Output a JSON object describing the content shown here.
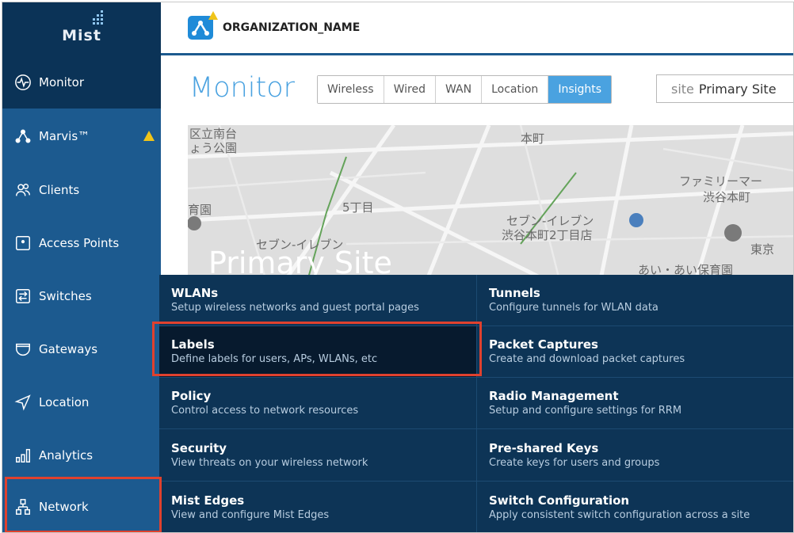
{
  "app": {
    "logo_text": "Mist",
    "org_name": "ORGANIZATION_NAME"
  },
  "sidebar": {
    "items": [
      {
        "label": "Monitor",
        "icon": "pulse-icon",
        "active": true
      },
      {
        "label": "Marvis™",
        "icon": "marvis-icon",
        "warning": true
      },
      {
        "label": "Clients",
        "icon": "users-icon"
      },
      {
        "label": "Access Points",
        "icon": "access-point-icon"
      },
      {
        "label": "Switches",
        "icon": "switch-icon"
      },
      {
        "label": "Gateways",
        "icon": "gateway-icon"
      },
      {
        "label": "Location",
        "icon": "location-arrow-icon"
      },
      {
        "label": "Analytics",
        "icon": "bar-chart-icon"
      },
      {
        "label": "Network",
        "icon": "network-icon"
      }
    ]
  },
  "header": {
    "title": "Monitor",
    "tabs": [
      {
        "label": "Wireless"
      },
      {
        "label": "Wired"
      },
      {
        "label": "WAN"
      },
      {
        "label": "Location"
      },
      {
        "label": "Insights",
        "active": true
      }
    ],
    "site_label": "site",
    "site_value": "Primary Site"
  },
  "map": {
    "site_name": "Primary Site",
    "labels": [
      "区立南台",
      "ょう公園",
      "本町",
      "ファミリーマー",
      "渋谷本町",
      "5丁目",
      "セブン-イレブン",
      "渋谷本町2丁目店",
      "セブン-イレブン",
      "東京",
      "あい・あい保育園",
      "育園"
    ]
  },
  "network_menu": {
    "left": [
      {
        "title": "WLANs",
        "desc": "Setup wireless networks and guest portal pages"
      },
      {
        "title": "Labels",
        "desc": "Define labels for users, APs, WLANs, etc"
      },
      {
        "title": "Policy",
        "desc": "Control access to network resources"
      },
      {
        "title": "Security",
        "desc": "View threats on your wireless network"
      },
      {
        "title": "Mist Edges",
        "desc": "View and configure Mist Edges"
      }
    ],
    "right": [
      {
        "title": "Tunnels",
        "desc": "Configure tunnels for WLAN data"
      },
      {
        "title": "Packet Captures",
        "desc": "Create and download packet captures"
      },
      {
        "title": "Radio Management",
        "desc": "Setup and configure settings for RRM"
      },
      {
        "title": "Pre-shared Keys",
        "desc": "Create keys for users and groups"
      },
      {
        "title": "Switch Configuration",
        "desc": "Apply consistent switch configuration across a site"
      }
    ]
  },
  "colors": {
    "sidebar": "#1c5a8f",
    "sidebar_active": "#0b3357",
    "accent": "#4aa2e0",
    "menu_bg": "#0d3456",
    "highlight": "#e0412e",
    "warning": "#f0c419"
  }
}
